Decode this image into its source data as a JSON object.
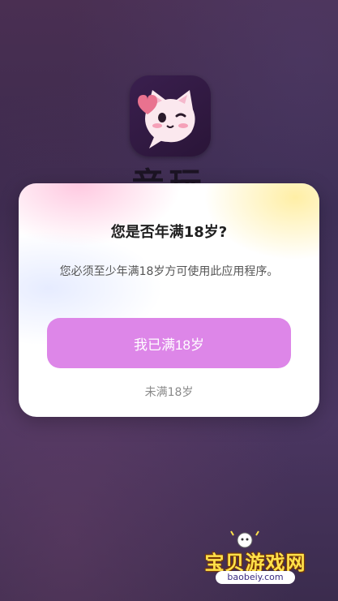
{
  "app": {
    "name": "音玩",
    "logo_icon": "cat-mascot-icon"
  },
  "dialog": {
    "title": "您是否年满18岁?",
    "message": "您必须至少年满18岁方可使用此应用程序。",
    "confirm_label": "我已满18岁",
    "decline_label": "未满18岁"
  },
  "colors": {
    "confirm_button": "#dd86e8",
    "background": "#3f2c50"
  },
  "watermark": {
    "text": "宝贝游戏网",
    "url": "baobeiy.com"
  }
}
